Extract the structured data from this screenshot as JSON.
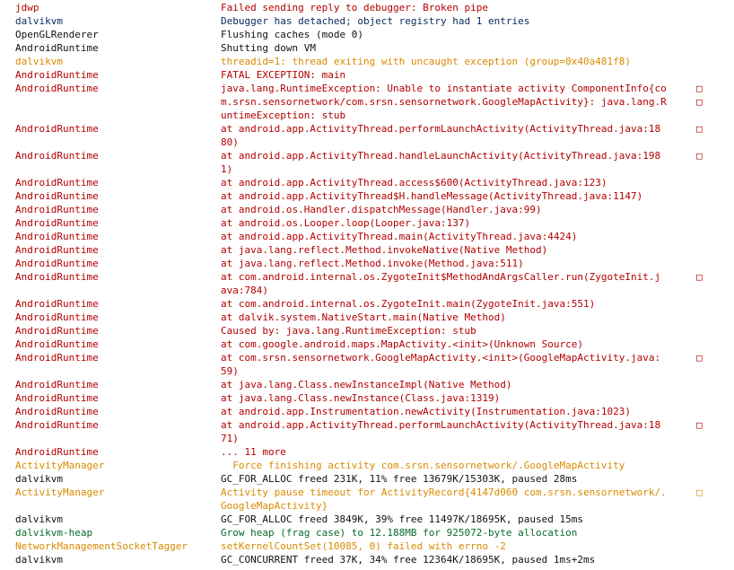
{
  "colors": {
    "error": "#b30000",
    "warn": "#d98a00",
    "info": "#111111",
    "debug": "#0b2b60",
    "verbose": "#0a6a2a"
  },
  "logcat": [
    {
      "tag": "jdwp",
      "level": "error",
      "msg": "Failed sending reply to debugger: Broken pipe"
    },
    {
      "tag": "dalvikvm",
      "level": "debug",
      "msg": "Debugger has detached; object registry had 1 entries"
    },
    {
      "tag": "OpenGLRenderer",
      "level": "info",
      "msg": "Flushing caches (mode 0)"
    },
    {
      "tag": "AndroidRuntime",
      "level": "info",
      "msg": "Shutting down VM"
    },
    {
      "tag": "dalvikvm",
      "level": "warn",
      "msg": "threadid=1: thread exiting with uncaught exception (group=0x40a481f8)"
    },
    {
      "tag": "AndroidRuntime",
      "level": "error",
      "msg": "FATAL EXCEPTION: main"
    },
    {
      "tag": "AndroidRuntime",
      "level": "error",
      "msg": "java.lang.RuntimeException: Unable to instantiate activity ComponentInfo{co",
      "cont": [
        "m.srsn.sensornetwork/com.srsn.sensornetwork.GoogleMapActivity}: java.lang.R",
        "untimeException: stub"
      ]
    },
    {
      "tag": "AndroidRuntime",
      "level": "error",
      "msg": "at android.app.ActivityThread.performLaunchActivity(ActivityThread.java:18",
      "cont": [
        "80)"
      ]
    },
    {
      "tag": "AndroidRuntime",
      "level": "error",
      "msg": "at android.app.ActivityThread.handleLaunchActivity(ActivityThread.java:198",
      "cont": [
        "1)"
      ]
    },
    {
      "tag": "AndroidRuntime",
      "level": "error",
      "msg": "at android.app.ActivityThread.access$600(ActivityThread.java:123)"
    },
    {
      "tag": "AndroidRuntime",
      "level": "error",
      "msg": "at android.app.ActivityThread$H.handleMessage(ActivityThread.java:1147)"
    },
    {
      "tag": "AndroidRuntime",
      "level": "error",
      "msg": "at android.os.Handler.dispatchMessage(Handler.java:99)"
    },
    {
      "tag": "AndroidRuntime",
      "level": "error",
      "msg": "at android.os.Looper.loop(Looper.java:137)"
    },
    {
      "tag": "AndroidRuntime",
      "level": "error",
      "msg": "at android.app.ActivityThread.main(ActivityThread.java:4424)"
    },
    {
      "tag": "AndroidRuntime",
      "level": "error",
      "msg": "at java.lang.reflect.Method.invokeNative(Native Method)"
    },
    {
      "tag": "AndroidRuntime",
      "level": "error",
      "msg": "at java.lang.reflect.Method.invoke(Method.java:511)"
    },
    {
      "tag": "AndroidRuntime",
      "level": "error",
      "msg": "at com.android.internal.os.ZygoteInit$MethodAndArgsCaller.run(ZygoteInit.j",
      "cont": [
        "ava:784)"
      ]
    },
    {
      "tag": "AndroidRuntime",
      "level": "error",
      "msg": "at com.android.internal.os.ZygoteInit.main(ZygoteInit.java:551)"
    },
    {
      "tag": "AndroidRuntime",
      "level": "error",
      "msg": "at dalvik.system.NativeStart.main(Native Method)"
    },
    {
      "tag": "AndroidRuntime",
      "level": "error",
      "msg": "Caused by: java.lang.RuntimeException: stub"
    },
    {
      "tag": "AndroidRuntime",
      "level": "error",
      "msg": "at com.google.android.maps.MapActivity.<init>(Unknown Source)"
    },
    {
      "tag": "AndroidRuntime",
      "level": "error",
      "msg": "at com.srsn.sensornetwork.GoogleMapActivity.<init>(GoogleMapActivity.java:",
      "cont": [
        "59)"
      ]
    },
    {
      "tag": "AndroidRuntime",
      "level": "error",
      "msg": "at java.lang.Class.newInstanceImpl(Native Method)"
    },
    {
      "tag": "AndroidRuntime",
      "level": "error",
      "msg": "at java.lang.Class.newInstance(Class.java:1319)"
    },
    {
      "tag": "AndroidRuntime",
      "level": "error",
      "msg": "at android.app.Instrumentation.newActivity(Instrumentation.java:1023)"
    },
    {
      "tag": "AndroidRuntime",
      "level": "error",
      "msg": "at android.app.ActivityThread.performLaunchActivity(ActivityThread.java:18",
      "cont": [
        "71)"
      ]
    },
    {
      "tag": "AndroidRuntime",
      "level": "error",
      "msg": "... 11 more"
    },
    {
      "tag": "ActivityManager",
      "level": "warn",
      "msg": "  Force finishing activity com.srsn.sensornetwork/.GoogleMapActivity"
    },
    {
      "tag": "dalvikvm",
      "level": "info",
      "msg": "GC_FOR_ALLOC freed 231K, 11% free 13679K/15303K, paused 28ms"
    },
    {
      "tag": "ActivityManager",
      "level": "warn",
      "msg": "Activity pause timeout for ActivityRecord{4147d060 com.srsn.sensornetwork/.",
      "cont": [
        "GoogleMapActivity}"
      ]
    },
    {
      "tag": "dalvikvm",
      "level": "info",
      "msg": "GC_FOR_ALLOC freed 3849K, 39% free 11497K/18695K, paused 15ms"
    },
    {
      "tag": "dalvikvm-heap",
      "level": "verbose",
      "msg": "Grow heap (frag case) to 12.188MB for 925072-byte allocation"
    },
    {
      "tag": "NetworkManagementSocketTagger",
      "level": "warn",
      "msg": "setKernelCountSet(10085, 0) failed with errno -2"
    },
    {
      "tag": "dalvikvm",
      "level": "info",
      "msg": "GC_CONCURRENT freed 37K, 34% free 12364K/18695K, paused 1ms+2ms"
    }
  ],
  "wrap_marker": "□"
}
